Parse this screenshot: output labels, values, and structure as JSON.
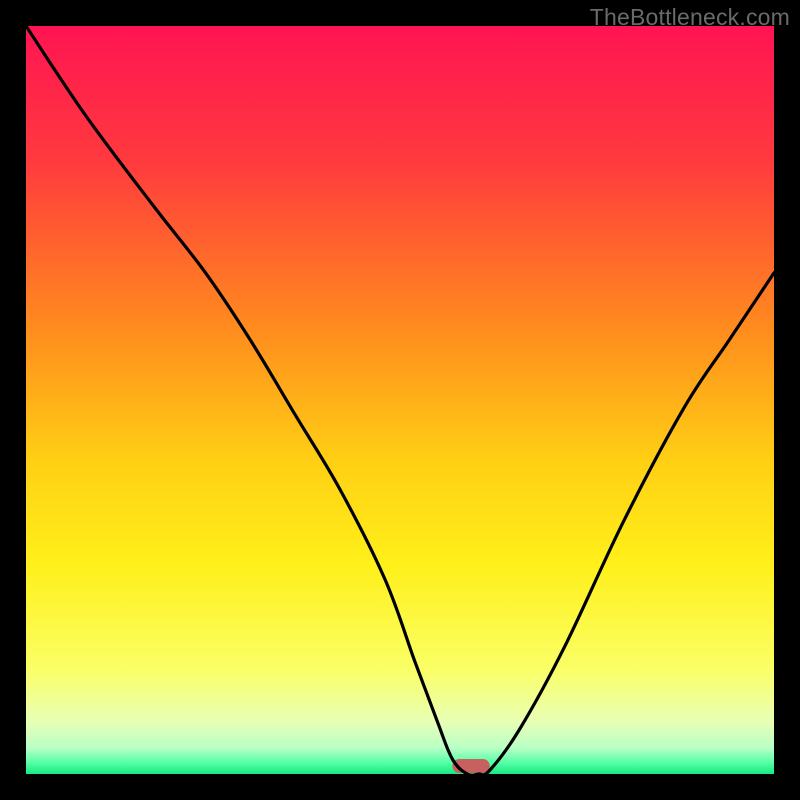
{
  "watermark": "TheBottleneck.com",
  "chart_data": {
    "type": "line",
    "title": "",
    "xlabel": "",
    "ylabel": "",
    "xlim": [
      0,
      100
    ],
    "ylim": [
      0,
      100
    ],
    "series": [
      {
        "name": "bottleneck-curve",
        "x": [
          0,
          8,
          17,
          24,
          30,
          36,
          42,
          48,
          52,
          55,
          57,
          59,
          60.5,
          62,
          66,
          72,
          80,
          88,
          94,
          100
        ],
        "y": [
          100,
          88,
          76,
          67,
          58,
          48,
          38,
          26,
          15,
          7,
          2,
          0,
          0,
          0.5,
          6,
          17,
          34,
          49,
          58,
          67
        ]
      }
    ],
    "marker": {
      "x_start": 57,
      "x_end": 62,
      "color": "#c86060"
    },
    "gradient_stops": [
      {
        "offset": 0.0,
        "color": "#ff1452"
      },
      {
        "offset": 0.18,
        "color": "#ff3a3e"
      },
      {
        "offset": 0.4,
        "color": "#ff8a1e"
      },
      {
        "offset": 0.58,
        "color": "#ffcf14"
      },
      {
        "offset": 0.72,
        "color": "#fff01a"
      },
      {
        "offset": 0.86,
        "color": "#faff66"
      },
      {
        "offset": 0.93,
        "color": "#e8ffb4"
      },
      {
        "offset": 0.965,
        "color": "#b9ffc6"
      },
      {
        "offset": 0.985,
        "color": "#54ffa5"
      },
      {
        "offset": 1.0,
        "color": "#18e880"
      }
    ]
  }
}
